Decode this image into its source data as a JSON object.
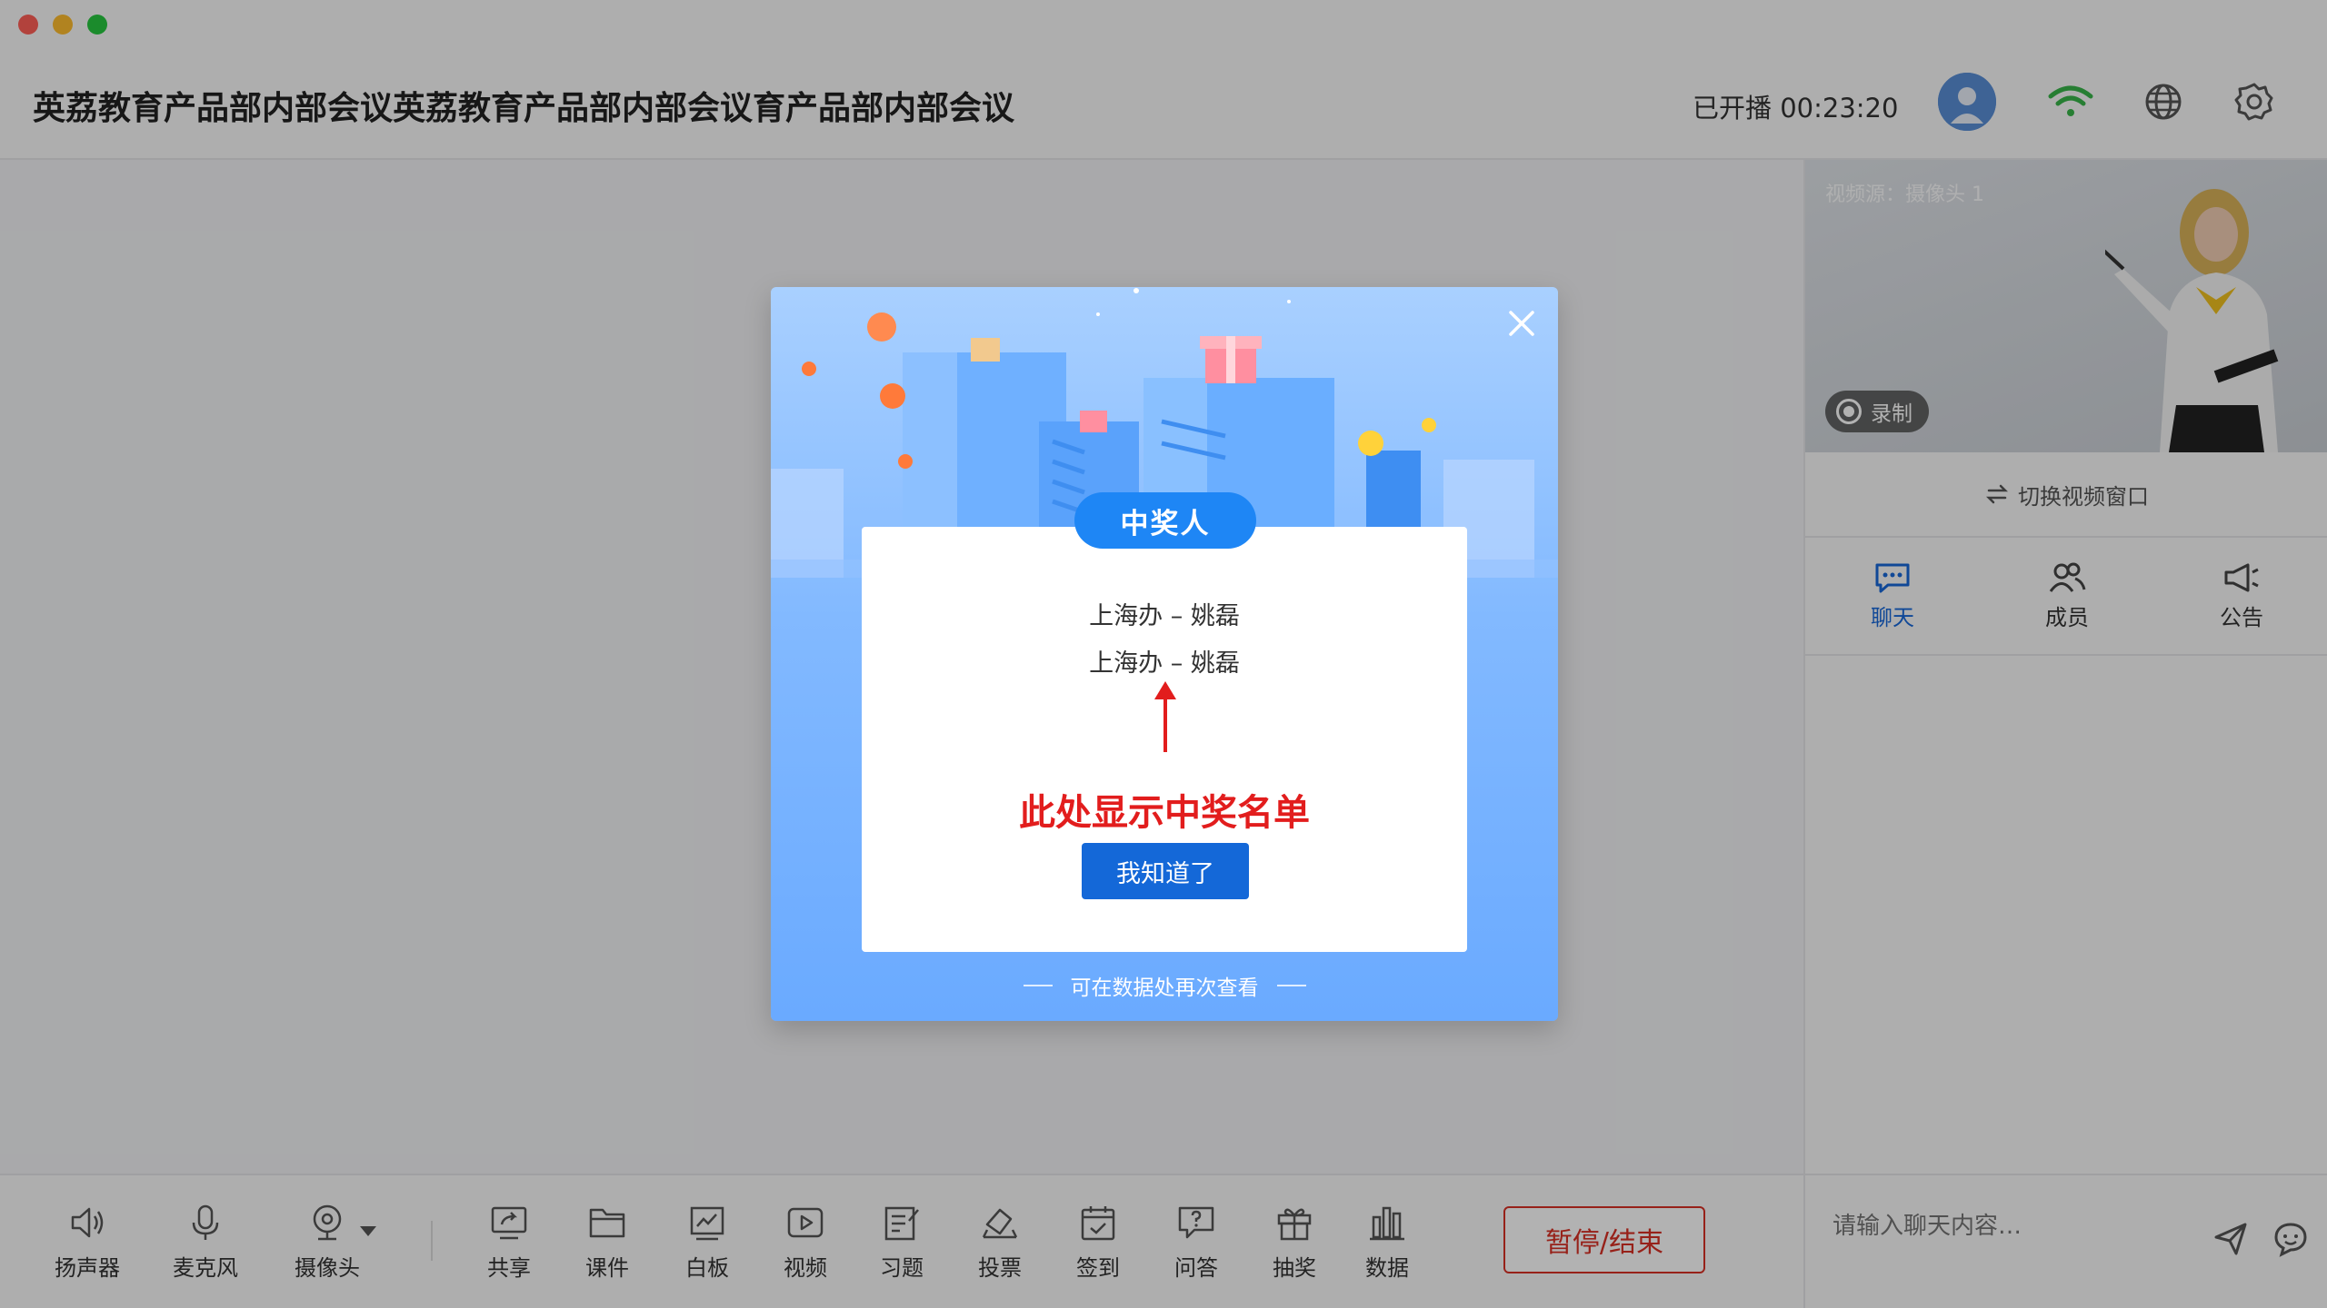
{
  "window": {
    "meeting_title": "英荔教育产品部内部会议英荔教育产品部内部会议育产品部内部会议",
    "live_status": "已开播 00:23:20"
  },
  "icons": {
    "avatar": "avatar-icon",
    "network": "wifi-icon",
    "language": "globe-icon",
    "settings": "gear-icon"
  },
  "sidebar": {
    "video_source": "视频源：摄像头 1",
    "record_label": "录制",
    "switch_window": "切换视频窗口",
    "tabs": [
      {
        "label": "聊天",
        "icon": "chat-icon",
        "active": true
      },
      {
        "label": "成员",
        "icon": "members-icon",
        "active": false
      },
      {
        "label": "公告",
        "icon": "announcement-icon",
        "active": false
      }
    ],
    "chat_placeholder": "请输入聊天内容…"
  },
  "toolbar": {
    "items": [
      {
        "label": "扬声器",
        "icon": "speaker-icon"
      },
      {
        "label": "麦克风",
        "icon": "microphone-icon"
      },
      {
        "label": "摄像头",
        "icon": "camera-icon"
      },
      {
        "label": "共享",
        "icon": "share-screen-icon"
      },
      {
        "label": "课件",
        "icon": "folder-icon"
      },
      {
        "label": "白板",
        "icon": "whiteboard-icon"
      },
      {
        "label": "视频",
        "icon": "video-icon"
      },
      {
        "label": "习题",
        "icon": "exercise-icon"
      },
      {
        "label": "投票",
        "icon": "vote-icon"
      },
      {
        "label": "签到",
        "icon": "checkin-icon"
      },
      {
        "label": "问答",
        "icon": "qa-icon"
      },
      {
        "label": "抽奖",
        "icon": "gift-icon"
      },
      {
        "label": "数据",
        "icon": "chart-icon"
      }
    ],
    "end_label": "暂停/结束"
  },
  "modal": {
    "title": "中奖人",
    "winners": [
      "上海办 – 姚磊",
      "上海办 – 姚磊"
    ],
    "annotation": "此处显示中奖名单",
    "ok_label": "我知道了",
    "footnote": "可在数据处再次查看"
  },
  "colors": {
    "accent": "#1468d8",
    "pill": "#1e86f5",
    "danger": "#d93025",
    "annotation": "#e21d1d"
  }
}
